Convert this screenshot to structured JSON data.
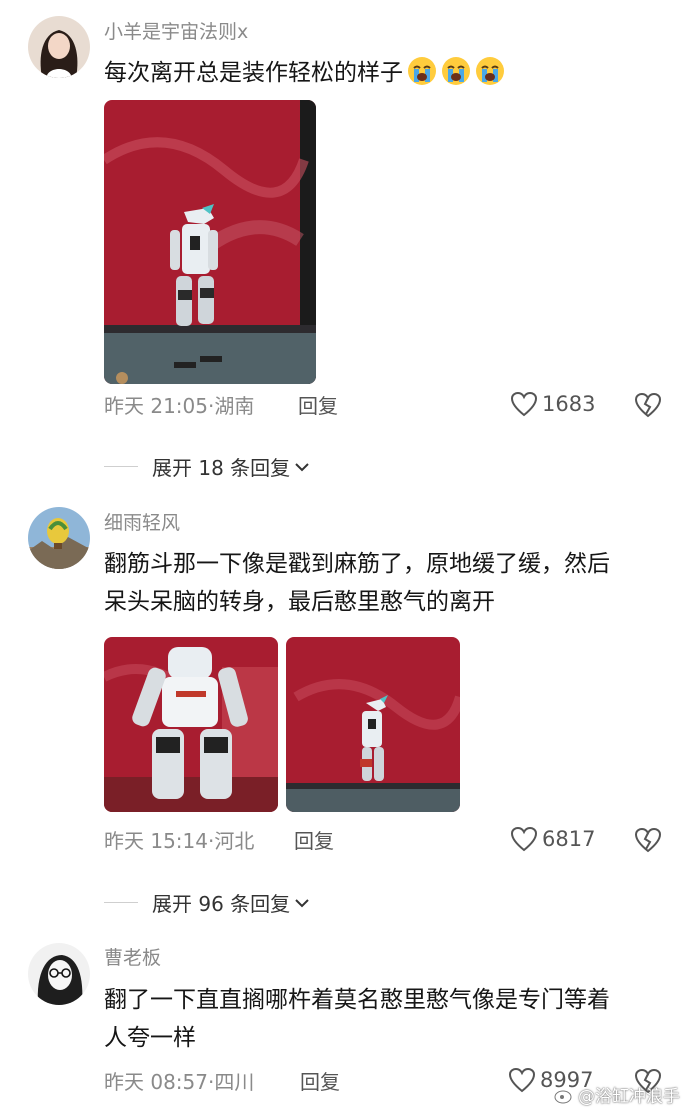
{
  "comments": [
    {
      "username": "小羊是宇宙法则x",
      "text": "每次离开总是装作轻松的样子",
      "emoji": [
        "loudly-crying-face",
        "loudly-crying-face",
        "loudly-crying-face"
      ],
      "time": "昨天 21:05",
      "location": "湖南",
      "reply_label": "回复",
      "likes": "1683",
      "expand": "展开 18 条回复"
    },
    {
      "username": "细雨轻风",
      "text_lines": [
        "翻筋斗那一下像是戳到麻筋了，原地缓了缓，然后",
        "呆头呆脑的转身，最后憨里憨气的离开"
      ],
      "time": "昨天 15:14",
      "location": "河北",
      "reply_label": "回复",
      "likes": "6817",
      "expand": "展开 96 条回复"
    },
    {
      "username": "曹老板",
      "text_lines": [
        "翻了一下直直搁哪杵着莫名憨里憨气像是专门等着",
        "人夸一样"
      ],
      "time": "昨天 08:57",
      "location": "四川",
      "reply_label": "回复",
      "likes": "8997"
    }
  ],
  "watermark": "@浴缸冲浪手",
  "colors": {
    "stage_red": "#b32235",
    "robot_white": "#e9eef2",
    "accent_teal": "#4fc3c6"
  }
}
